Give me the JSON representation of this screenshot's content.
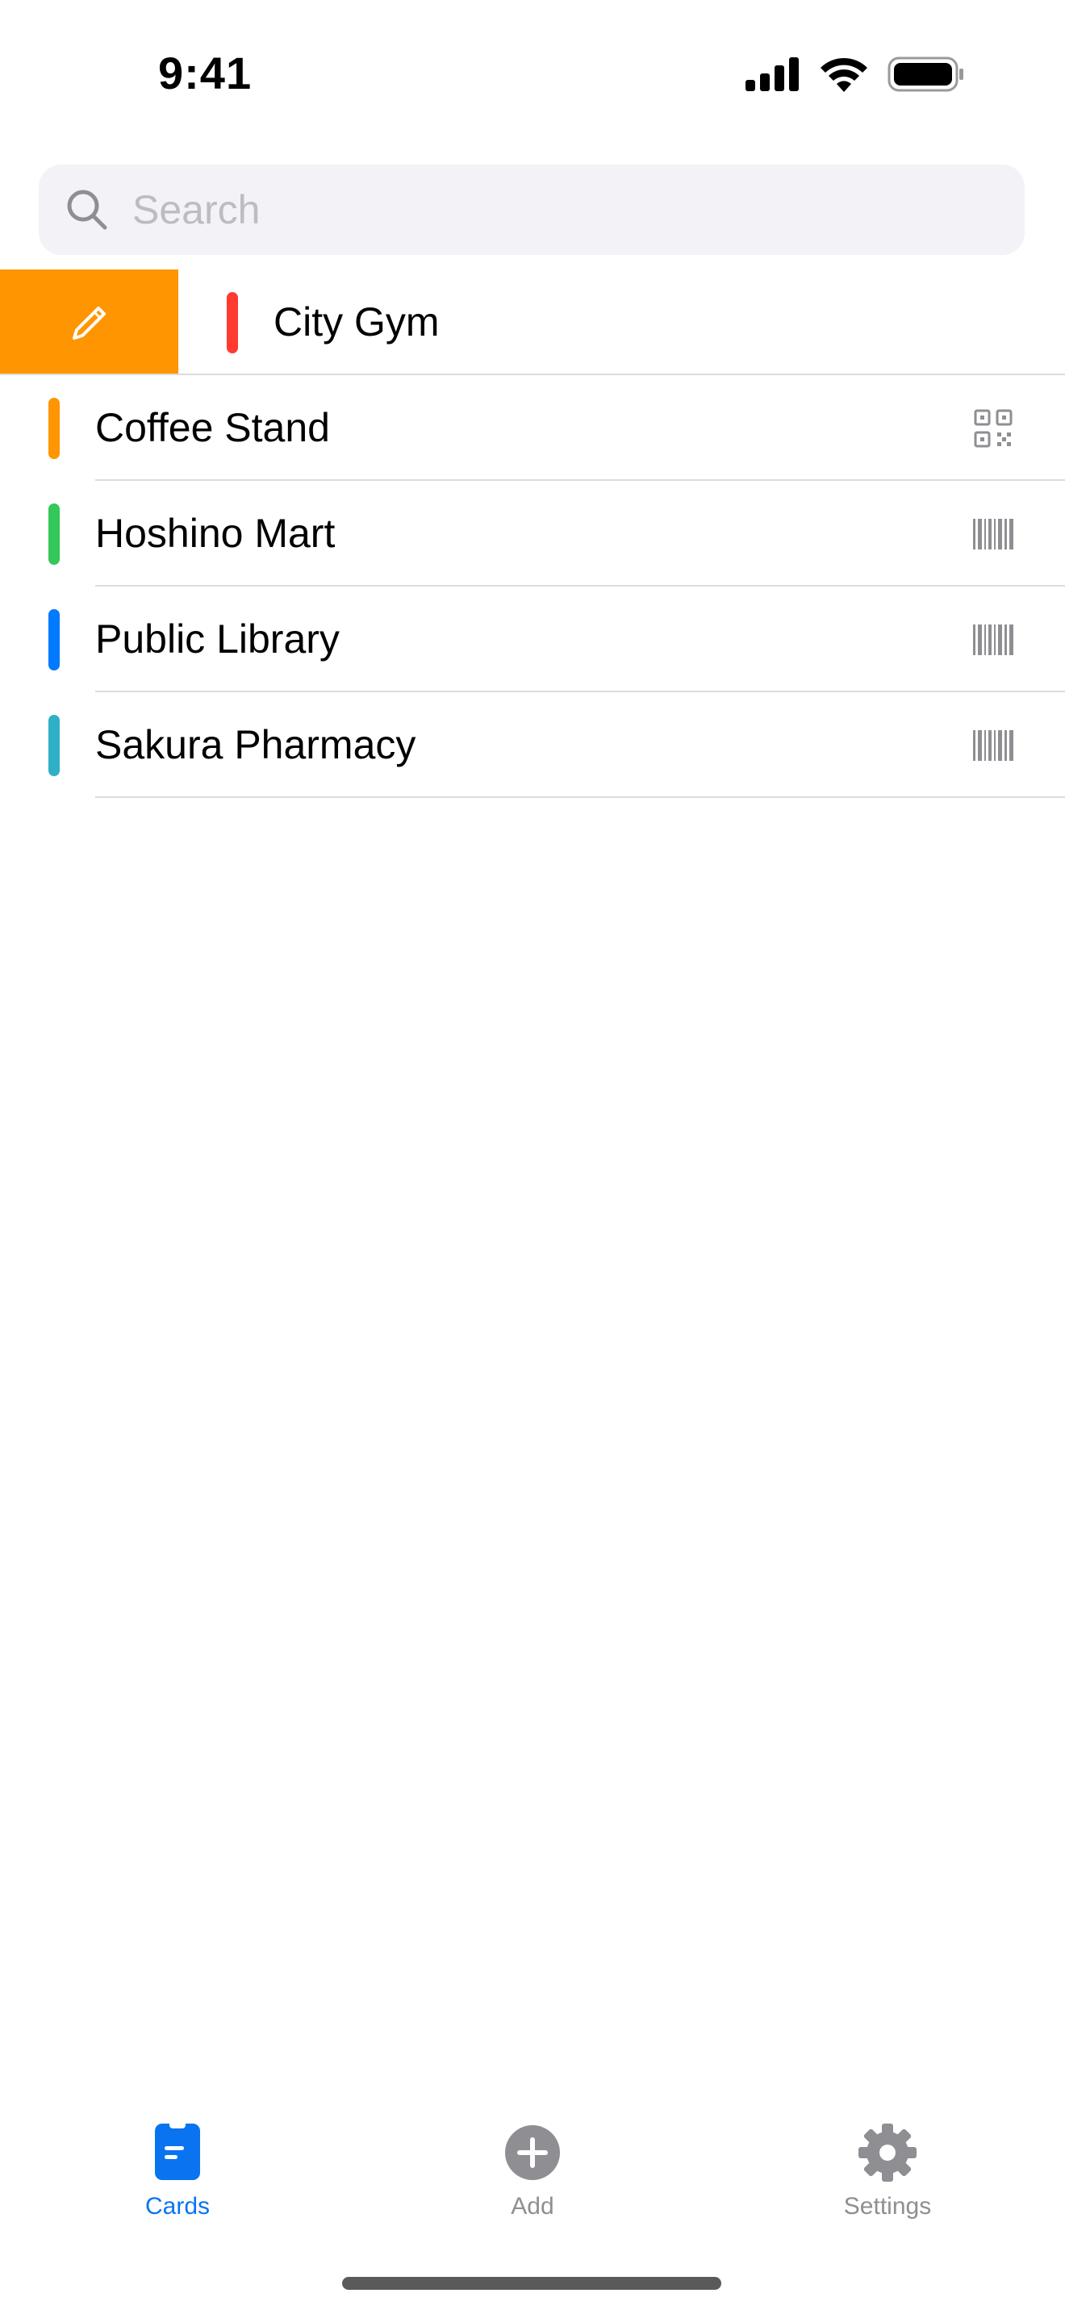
{
  "status_bar": {
    "time": "9:41"
  },
  "search": {
    "placeholder": "Search",
    "value": ""
  },
  "cards": [
    {
      "name": "City Gym",
      "color": "#ff3b30",
      "code_type": "none",
      "swiped": true
    },
    {
      "name": "Coffee Stand",
      "color": "#ff9500",
      "code_type": "qr-code-icon",
      "swiped": false
    },
    {
      "name": "Hoshino Mart",
      "color": "#34c759",
      "code_type": "barcode-icon",
      "swiped": false
    },
    {
      "name": "Public Library",
      "color": "#007aff",
      "code_type": "barcode-icon",
      "swiped": false
    },
    {
      "name": "Sakura Pharmacy",
      "color": "#30b0c7",
      "code_type": "barcode-icon",
      "swiped": false
    }
  ],
  "swipe_action": {
    "icon": "pencil-icon",
    "color": "#ff9500"
  },
  "tab_bar": {
    "tabs": [
      {
        "label": "Cards",
        "icon": "card-icon",
        "active": true
      },
      {
        "label": "Add",
        "icon": "plus-circle-icon",
        "active": false
      },
      {
        "label": "Settings",
        "icon": "gear-icon",
        "active": false
      }
    ]
  },
  "colors": {
    "accent": "#0a74f0",
    "inactive": "#8e8e93"
  }
}
